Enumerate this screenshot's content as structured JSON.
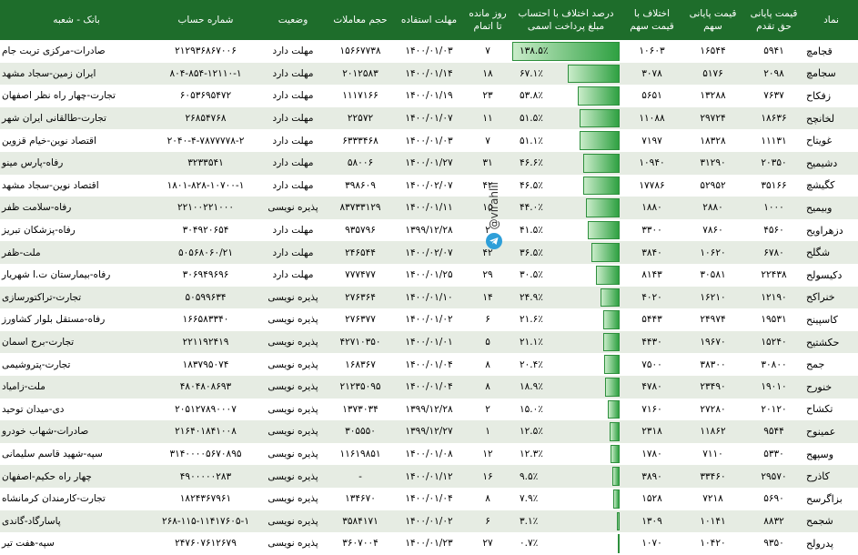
{
  "headers": {
    "name": "نماد",
    "rights_price": "قیمت پایانی حق تقدم",
    "stock_price": "قیمت پایانی سهم",
    "diff_price": "اختلاف با قیمت سهم",
    "diff_percent": "درصد اختلاف با احتساب مبلغ پرداخت اسمی",
    "days_left": "روز مانده تا اتمام",
    "deadline": "مهلت استفاده",
    "volume": "حجم معاملات",
    "status": "وضعیت",
    "account": "شماره حساب",
    "bank": "بانک - شعبه"
  },
  "watermark": "@virahlil",
  "rows": [
    {
      "name": "قجامچ",
      "rights": "۵۹۴۱",
      "stock": "۱۶۵۴۴",
      "diff": "۱۰۶۰۳",
      "pct": "۱۳۸.۵٪",
      "pct_value": 138.5,
      "days": "۷",
      "deadline": "۱۴۰۰/۰۱/۰۳",
      "volume": "۱۵۶۶۷۷۳۸",
      "status": "مهلت دارد",
      "account": "۲۱۲۹۳۶۸۶۷۰۰۶",
      "bank": "صادرات-مرکزی تربت جام"
    },
    {
      "name": "سجامچ",
      "rights": "۲۰۹۸",
      "stock": "۵۱۷۶",
      "diff": "۳۰۷۸",
      "pct": "۶۷.۱٪",
      "pct_value": 67.1,
      "days": "۱۸",
      "deadline": "۱۴۰۰/۰۱/۱۴",
      "volume": "۲۰۱۲۵۸۳",
      "status": "مهلت دارد",
      "account": "۸۰۴-۸۵۴-۱۲۱۱۰-۱",
      "bank": "ایران زمین-سجاد مشهد"
    },
    {
      "name": "زفکاح",
      "rights": "۷۶۳۷",
      "stock": "۱۳۲۸۸",
      "diff": "۵۶۵۱",
      "pct": "۵۳.۸٪",
      "pct_value": 53.8,
      "days": "۲۳",
      "deadline": "۱۴۰۰/۰۱/۱۹",
      "volume": "۱۱۱۷۱۶۶",
      "status": "مهلت دارد",
      "account": "۶۰۵۳۶۹۵۴۷۲",
      "bank": "تجارت-چهار راه نظر اصفهان"
    },
    {
      "name": "لخانچح",
      "rights": "۱۸۶۳۶",
      "stock": "۲۹۷۲۴",
      "diff": "۱۱۰۸۸",
      "pct": "۵۱.۵٪",
      "pct_value": 51.5,
      "days": "۱۱",
      "deadline": "۱۴۰۰/۰۱/۰۷",
      "volume": "۲۲۵۷۲",
      "status": "مهلت دارد",
      "account": "۲۶۸۵۴۷۶۸",
      "bank": "تجارت-طالقانی ایران شهر"
    },
    {
      "name": "غویتاح",
      "rights": "۱۱۱۳۱",
      "stock": "۱۸۳۲۸",
      "diff": "۷۱۹۷",
      "pct": "۵۱.۱٪",
      "pct_value": 51.1,
      "days": "۷",
      "deadline": "۱۴۰۰/۰۱/۰۳",
      "volume": "۶۳۳۳۴۶۸",
      "status": "مهلت دارد",
      "account": "۲۰۴۰-۴-۷۸۷۷۷۷۸-۲",
      "bank": "اقتصاد نوین-خیام قزوین"
    },
    {
      "name": "دشیمیح",
      "rights": "۲۰۳۵۰",
      "stock": "۳۱۲۹۰",
      "diff": "۱۰۹۴۰",
      "pct": "۴۶.۶٪",
      "pct_value": 46.6,
      "days": "۳۱",
      "deadline": "۱۴۰۰/۰۱/۲۷",
      "volume": "۵۸۰۰۶",
      "status": "مهلت دارد",
      "account": "۳۲۳۳۵۴۱",
      "bank": "رفاه-پارس مینو"
    },
    {
      "name": "کگیشچ",
      "rights": "۳۵۱۶۶",
      "stock": "۵۲۹۵۲",
      "diff": "۱۷۷۸۶",
      "pct": "۴۶.۵٪",
      "pct_value": 46.5,
      "days": "۴۲",
      "deadline": "۱۴۰۰/۰۲/۰۷",
      "volume": "۳۹۸۶۰۹",
      "status": "مهلت دارد",
      "account": "۱۸۰۱-۸۲۸-۱۰۷۰۰-۱",
      "bank": "اقتصاد نوین-سجاد مشهد"
    },
    {
      "name": "وبیمیح",
      "rights": "۱۰۰۰",
      "stock": "۲۸۸۰",
      "diff": "۱۸۸۰",
      "pct": "۴۴.۰٪",
      "pct_value": 44.0,
      "days": "۱۵",
      "deadline": "۱۴۰۰/۰۱/۱۱",
      "volume": "۸۳۷۳۳۱۲۹",
      "status": "پذیره نویسی",
      "account": "۲۲۱۰۰۲۲۱۰۰۰",
      "bank": "رفاه-سلامت ظفر"
    },
    {
      "name": "دزهراویح",
      "rights": "۴۵۶۰",
      "stock": "۷۸۶۰",
      "diff": "۳۳۰۰",
      "pct": "۴۱.۵٪",
      "pct_value": 41.5,
      "days": "۲",
      "deadline": "۱۳۹۹/۱۲/۲۸",
      "volume": "۹۳۵۷۹۶",
      "status": "مهلت دارد",
      "account": "۳۰۴۹۲۰۶۵۴",
      "bank": "رفاه-پزشکان تبریز"
    },
    {
      "name": "شگلح",
      "rights": "۶۷۸۰",
      "stock": "۱۰۶۲۰",
      "diff": "۳۸۴۰",
      "pct": "۳۶.۵٪",
      "pct_value": 36.5,
      "days": "۴۲",
      "deadline": "۱۴۰۰/۰۲/۰۷",
      "volume": "۲۴۶۵۴۴",
      "status": "مهلت دارد",
      "account": "۵۰۵۶۸۰۶۰/۲۱",
      "bank": "ملت-ظفر"
    },
    {
      "name": "دکیسولح",
      "rights": "۲۲۴۳۸",
      "stock": "۳۰۵۸۱",
      "diff": "۸۱۴۳",
      "pct": "۳۰.۵٪",
      "pct_value": 30.5,
      "days": "۲۹",
      "deadline": "۱۴۰۰/۰۱/۲۵",
      "volume": "۷۷۷۴۷۷",
      "status": "مهلت دارد",
      "account": "۳۰۶۹۴۹۶۹۶",
      "bank": "رفاه-بیمارستان ت.ا شهریار"
    },
    {
      "name": "خنراکح",
      "rights": "۱۲۱۹۰",
      "stock": "۱۶۲۱۰",
      "diff": "۴۰۲۰",
      "pct": "۲۴.۹٪",
      "pct_value": 24.9,
      "days": "۱۴",
      "deadline": "۱۴۰۰/۰۱/۱۰",
      "volume": "۲۷۶۳۶۴",
      "status": "پذیره نویسی",
      "account": "۵۰۵۹۹۶۳۴",
      "bank": "تجارت-تراکتورسازی"
    },
    {
      "name": "کاسپینح",
      "rights": "۱۹۵۳۱",
      "stock": "۲۴۹۷۴",
      "diff": "۵۴۴۳",
      "pct": "۲۱.۶٪",
      "pct_value": 21.6,
      "days": "۶",
      "deadline": "۱۴۰۰/۰۱/۰۲",
      "volume": "۲۷۶۳۷۷",
      "status": "پذیره نویسی",
      "account": "۱۶۶۵۸۳۳۴۰",
      "bank": "رفاه-مستقل بلوار کشاورز"
    },
    {
      "name": "حکشتیح",
      "rights": "۱۵۲۴۰",
      "stock": "۱۹۶۷۰",
      "diff": "۴۴۳۰",
      "pct": "۲۱.۱٪",
      "pct_value": 21.1,
      "days": "۵",
      "deadline": "۱۴۰۰/۰۱/۰۱",
      "volume": "۴۲۷۱۰۳۵۰",
      "status": "پذیره نویسی",
      "account": "۲۲۱۱۹۲۴۱۹",
      "bank": "تجارت-برج اسمان"
    },
    {
      "name": "جمح",
      "rights": "۳۰۸۰۰",
      "stock": "۳۸۳۰۰",
      "diff": "۷۵۰۰",
      "pct": "۲۰.۴٪",
      "pct_value": 20.4,
      "days": "۸",
      "deadline": "۱۴۰۰/۰۱/۰۴",
      "volume": "۱۶۸۳۶۷",
      "status": "پذیره نویسی",
      "account": "۱۸۳۷۹۵۰۷۴",
      "bank": "تجارت-پتروشیمی"
    },
    {
      "name": "خنورح",
      "rights": "۱۹۰۱۰",
      "stock": "۲۳۴۹۰",
      "diff": "۴۷۸۰",
      "pct": "۱۸.۹٪",
      "pct_value": 18.9,
      "days": "۸",
      "deadline": "۱۴۰۰/۰۱/۰۴",
      "volume": "۲۱۲۳۵۰۹۵",
      "status": "پذیره نویسی",
      "account": "۴۸۰۴۸۰۸۶۹۳",
      "bank": "ملت-زامیاد"
    },
    {
      "name": "تکشاح",
      "rights": "۲۰۱۲۰",
      "stock": "۲۷۲۸۰",
      "diff": "۷۱۶۰",
      "pct": "۱۵.۰٪",
      "pct_value": 15.0,
      "days": "۲",
      "deadline": "۱۳۹۹/۱۲/۲۸",
      "volume": "۱۳۷۳۰۳۴",
      "status": "پذیره نویسی",
      "account": "۲۰۵۱۲۷۸۹۰۰۰۷",
      "bank": "دی-میدان توحید"
    },
    {
      "name": "عمینوح",
      "rights": "۹۵۴۴",
      "stock": "۱۱۸۶۲",
      "diff": "۲۳۱۸",
      "pct": "۱۲.۵٪",
      "pct_value": 12.5,
      "days": "۱",
      "deadline": "۱۳۹۹/۱۲/۲۷",
      "volume": "۳۰۵۵۵۰",
      "status": "پذیره نویسی",
      "account": "۲۱۶۴۰۱۸۴۱۰۰۸",
      "bank": "صادرات-شهاب خودرو"
    },
    {
      "name": "وسپهح",
      "rights": "۵۳۳۰",
      "stock": "۷۱۱۰",
      "diff": "۱۷۸۰",
      "pct": "۱۲.۳٪",
      "pct_value": 12.3,
      "days": "۱۲",
      "deadline": "۱۴۰۰/۰۱/۰۸",
      "volume": "۱۱۶۱۹۸۵۱",
      "status": "پذیره نویسی",
      "account": "۳۱۴۰۰۰۰۵۶۷۰۸۹۵",
      "bank": "سپه-شهید قاسم سلیمانی"
    },
    {
      "name": "کاذرح",
      "rights": "۲۹۵۷۰",
      "stock": "۳۳۴۶۰",
      "diff": "۳۸۹۰",
      "pct": "۹.۵٪",
      "pct_value": 9.5,
      "days": "۱۶",
      "deadline": "۱۴۰۰/۰۱/۱۲",
      "volume": "-",
      "status": "پذیره نویسی",
      "account": "۴۹۰۰۰۰۰۲۸۳",
      "bank": "چهار راه حکیم-اصفهان"
    },
    {
      "name": "بزاگرسح",
      "rights": "۵۶۹۰",
      "stock": "۷۲۱۸",
      "diff": "۱۵۲۸",
      "pct": "۷.۹٪",
      "pct_value": 7.9,
      "days": "۸",
      "deadline": "۱۴۰۰/۰۱/۰۴",
      "volume": "۱۳۴۶۷۰",
      "status": "پذیره نویسی",
      "account": "۱۸۲۴۳۶۷۹۶۱",
      "bank": "تجارت-کارمندان کرمانشاه"
    },
    {
      "name": "شجمح",
      "rights": "۸۸۳۲",
      "stock": "۱۰۱۴۱",
      "diff": "۱۳۰۹",
      "pct": "۳.۱٪",
      "pct_value": 3.1,
      "days": "۶",
      "deadline": "۱۴۰۰/۰۱/۰۲",
      "volume": "۳۵۸۴۱۷۱",
      "status": "پذیره نویسی",
      "account": "۲۶۸-۱۱۵-۱۱۴۱۷۶۰۵-۱",
      "bank": "پاسارگاد-گاندی"
    },
    {
      "name": "پدرولح",
      "rights": "۹۳۵۰",
      "stock": "۱۰۴۲۰",
      "diff": "۱۰۷۰",
      "pct": "۰.۷٪",
      "pct_value": 0.7,
      "days": "۲۷",
      "deadline": "۱۴۰۰/۰۱/۲۳",
      "volume": "۳۶۰۷۰۰۴",
      "status": "پذیره نویسی",
      "account": "۲۴۷۶۰۷۶۱۲۶۷۹",
      "bank": "سپه-هفت تیر"
    }
  ]
}
